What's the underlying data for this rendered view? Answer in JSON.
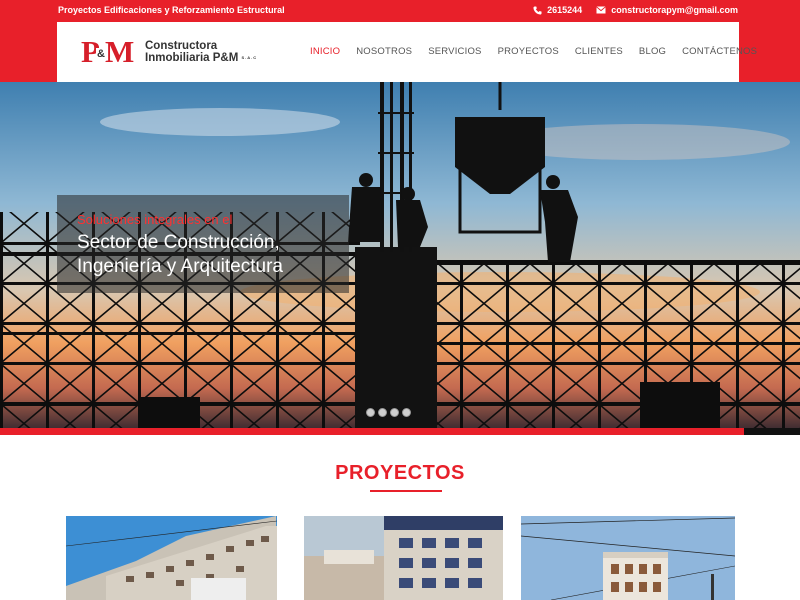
{
  "topbar": {
    "tagline": "Proyectos Edificaciones y Reforzamiento Estructural",
    "phone": "2615244",
    "email": "constructorapym@gmail.com",
    "phone_icon": "phone-icon",
    "email_icon": "envelope-icon"
  },
  "logo": {
    "mark_p": "P",
    "mark_amp": "&",
    "mark_m": "M",
    "line1": "Constructora",
    "line2": "Inmobiliaria P&M",
    "suffix": "S.A.C"
  },
  "nav": {
    "items": [
      "INICIO",
      "NOSOTROS",
      "SERVICIOS",
      "PROYECTOS",
      "CLIENTES",
      "BLOG",
      "CONTÁCTENOS"
    ],
    "active_index": 0
  },
  "hero": {
    "subtitle": "Soluciones integrales en el",
    "title_line1": "Sector de Construcción,",
    "title_line2": "Ingeniería y Arquitectura",
    "slides_count": 4
  },
  "projects": {
    "title": "PROYECTOS"
  },
  "colors": {
    "brand_red": "#e8202a",
    "text_dark": "#333333",
    "nav_text": "#555555"
  }
}
